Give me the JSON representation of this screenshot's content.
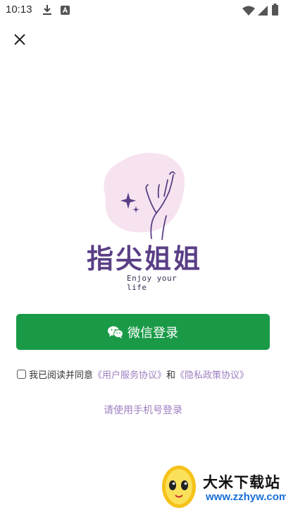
{
  "status_bar": {
    "time": "10:13"
  },
  "icons": {
    "close": "close-icon",
    "download": "download-icon",
    "app_notification": "a-letter-icon",
    "wifi": "wifi-icon",
    "signal": "signal-icon",
    "battery": "battery-icon",
    "wechat": "wechat-icon",
    "sparkle": "sparkle-icon",
    "hand": "hand-icon"
  },
  "brand": {
    "name": "指尖姐姐",
    "slogan": "Enjoy your life",
    "primary_color": "#5a3f86",
    "blob_color": "#f6e3ef"
  },
  "login": {
    "wechat_label": "微信登录",
    "wechat_color": "#1a9a47",
    "agreement_prefix": "我已阅读并同意",
    "user_agreement": "《用户服务协议》",
    "agreement_and": "和",
    "privacy_policy": "《隐私政策协议》",
    "phone_login": "请使用手机号登录",
    "link_color": "#9d7fc0"
  },
  "watermark": {
    "title": "大米下载站",
    "url": "www.zzhyw.com"
  }
}
